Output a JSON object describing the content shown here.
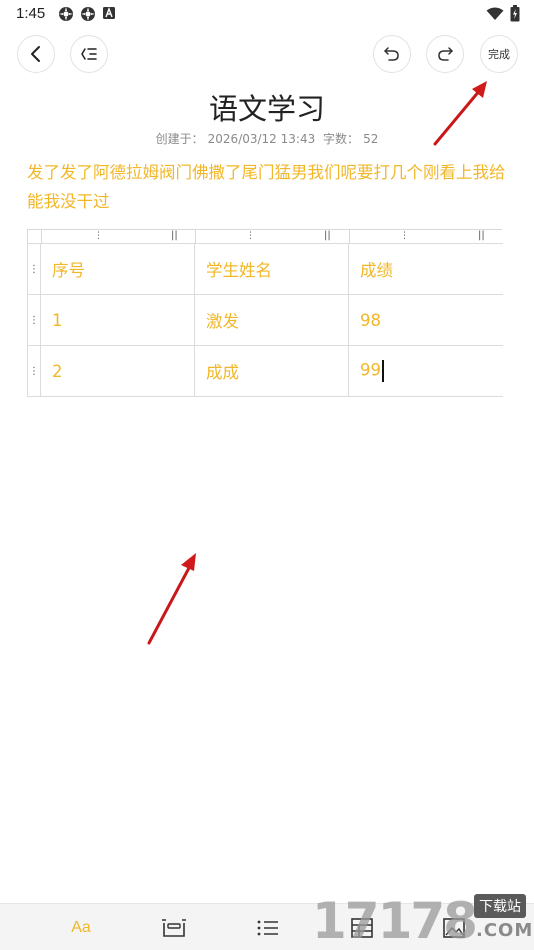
{
  "status_bar": {
    "time": "1:45",
    "icons_left": [
      "settings-gear-icon",
      "settings-gear-icon",
      "a-notification-icon"
    ],
    "icons_right": [
      "wifi-icon",
      "battery-charging-icon"
    ]
  },
  "toolbar": {
    "back_icon": "chevron-left-icon",
    "outline_icon": "outline-list-icon",
    "undo_icon": "undo-icon",
    "redo_icon": "redo-icon",
    "done_label": "完成"
  },
  "note": {
    "title": "语文学习",
    "created_label": "创建于：",
    "created_value": "2026/03/12 13:43",
    "count_label": "字数：",
    "count_value": "52",
    "body": "发了发了阿德拉姆阀门佛撒了尾门猛男我们呢要打几个刚看上我给能我没干过"
  },
  "table": {
    "rows": [
      [
        "序号",
        "学生姓名",
        "成绩"
      ],
      [
        "1",
        "激发",
        "98"
      ],
      [
        "2",
        "成成",
        "99"
      ]
    ]
  },
  "bottom_bar": {
    "text_style_label": "Aa",
    "icons": [
      "card-icon",
      "list-icon",
      "table-icon",
      "image-icon"
    ]
  },
  "watermark": {
    "digits": "17178",
    "badge": "下载站",
    "domain": ".COM"
  },
  "colors": {
    "accent": "#f2b728",
    "arrow": "#e02020"
  }
}
